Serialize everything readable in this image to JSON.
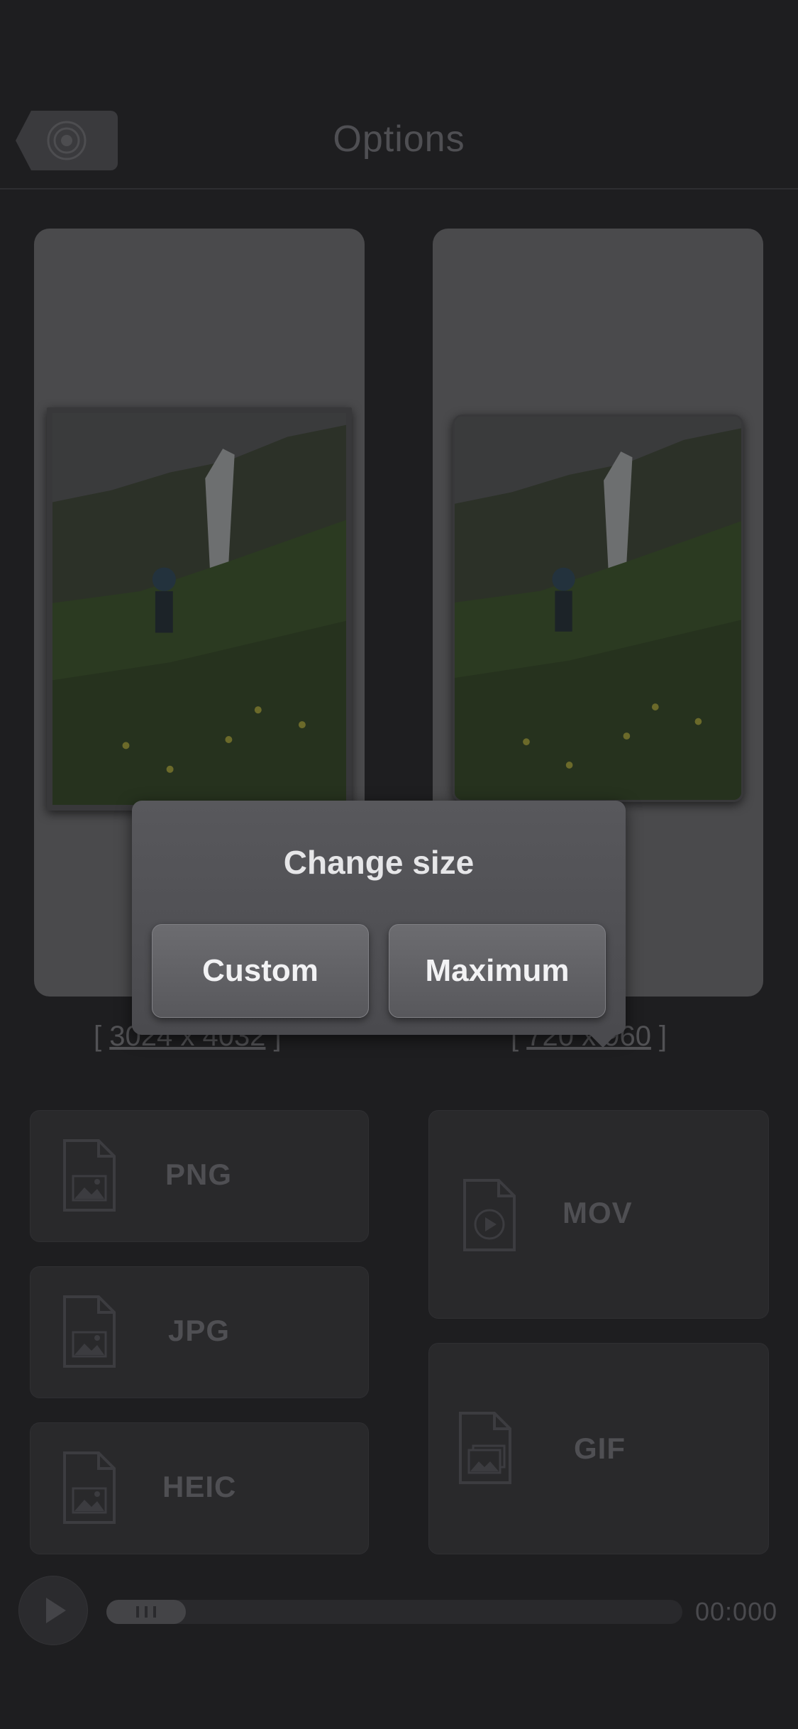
{
  "header": {
    "title": "Options",
    "back_icon": "camera-lens-icon"
  },
  "previews": {
    "left_size": {
      "open": "[ ",
      "value": "3024 x 4032",
      "close": " ]"
    },
    "right_size": {
      "open": "[ ",
      "value": "720 x 960",
      "close": " ]"
    }
  },
  "formats": {
    "png": "PNG",
    "jpg": "JPG",
    "heic": "HEIC",
    "mov": "MOV",
    "gif": "GIF"
  },
  "dialog": {
    "title": "Change size",
    "custom_label": "Custom",
    "maximum_label": "Maximum"
  },
  "player": {
    "time": "00:000",
    "progress": 0.0
  }
}
